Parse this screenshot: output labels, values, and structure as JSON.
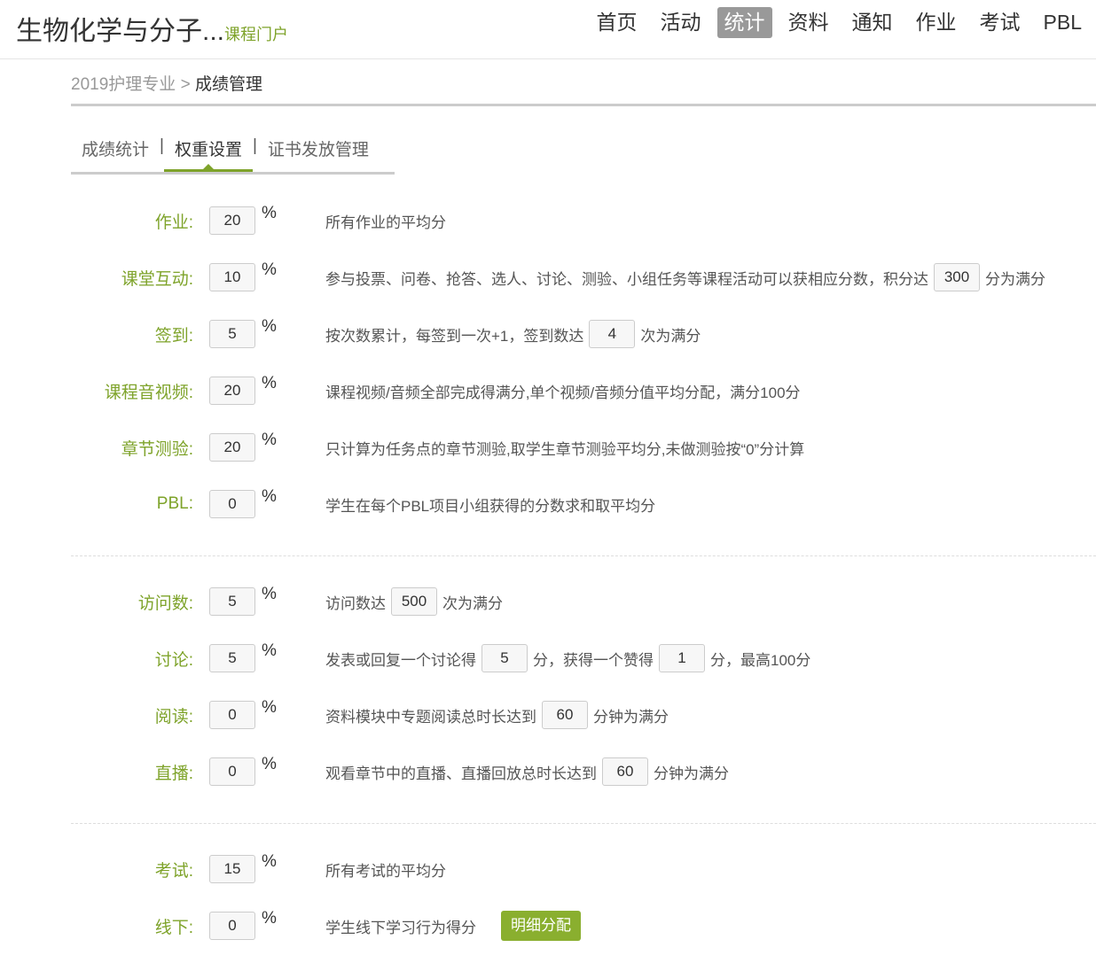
{
  "header": {
    "course_title": "生物化学与分子...",
    "portal": "课程门户",
    "nav": [
      "首页",
      "活动",
      "统计",
      "资料",
      "通知",
      "作业",
      "考试",
      "PBL"
    ],
    "active_nav": 2
  },
  "breadcrumb": {
    "parent": "2019护理专业",
    "separator": ">",
    "current": "成绩管理"
  },
  "tabs": {
    "items": [
      "成绩统计",
      "权重设置",
      "证书发放管理"
    ],
    "separator": "|",
    "active": 1
  },
  "colors": {
    "accent": "#7ea32a",
    "button": "#8aaf2f"
  },
  "percent_sign": "%",
  "groups": [
    [
      {
        "label": "作业:",
        "value": "20",
        "desc": [
          {
            "t": "所有作业的平均分"
          }
        ]
      },
      {
        "label": "课堂互动:",
        "value": "10",
        "desc": [
          {
            "t": "参与投票、问卷、抢答、选人、讨论、测验、小组任务等课程活动可以获相应分数，积分达"
          },
          {
            "v": "300"
          },
          {
            "t": "分为满分"
          }
        ]
      },
      {
        "label": "签到:",
        "value": "5",
        "desc": [
          {
            "t": "按次数累计，每签到一次+1，签到数达"
          },
          {
            "v": "4"
          },
          {
            "t": "次为满分"
          }
        ]
      },
      {
        "label": "课程音视频:",
        "value": "20",
        "desc": [
          {
            "t": "课程视频/音频全部完成得满分,单个视频/音频分值平均分配，满分100分"
          }
        ]
      },
      {
        "label": "章节测验:",
        "value": "20",
        "desc": [
          {
            "t": "只计算为任务点的章节测验,取学生章节测验平均分,未做测验按“0”分计算"
          }
        ]
      },
      {
        "label": "PBL:",
        "value": "0",
        "desc": [
          {
            "t": "学生在每个PBL项目小组获得的分数求和取平均分"
          }
        ]
      }
    ],
    [
      {
        "label": "访问数:",
        "value": "5",
        "desc": [
          {
            "t": "访问数达"
          },
          {
            "v": "500"
          },
          {
            "t": "次为满分"
          }
        ]
      },
      {
        "label": "讨论:",
        "value": "5",
        "desc": [
          {
            "t": "发表或回复一个讨论得"
          },
          {
            "v": "5"
          },
          {
            "t": "分，获得一个赞得"
          },
          {
            "v": "1"
          },
          {
            "t": "分，最高100分"
          }
        ]
      },
      {
        "label": "阅读:",
        "value": "0",
        "desc": [
          {
            "t": "资料模块中专题阅读总时长达到"
          },
          {
            "v": "60"
          },
          {
            "t": "分钟为满分"
          }
        ]
      },
      {
        "label": "直播:",
        "value": "0",
        "desc": [
          {
            "t": "观看章节中的直播、直播回放总时长达到"
          },
          {
            "v": "60"
          },
          {
            "t": "分钟为满分"
          }
        ]
      }
    ],
    [
      {
        "label": "考试:",
        "value": "15",
        "desc": [
          {
            "t": "所有考试的平均分"
          }
        ]
      },
      {
        "label": "线下:",
        "value": "0",
        "desc": [
          {
            "t": "学生线下学习行为得分"
          },
          {
            "b": "明细分配"
          }
        ]
      }
    ]
  ]
}
